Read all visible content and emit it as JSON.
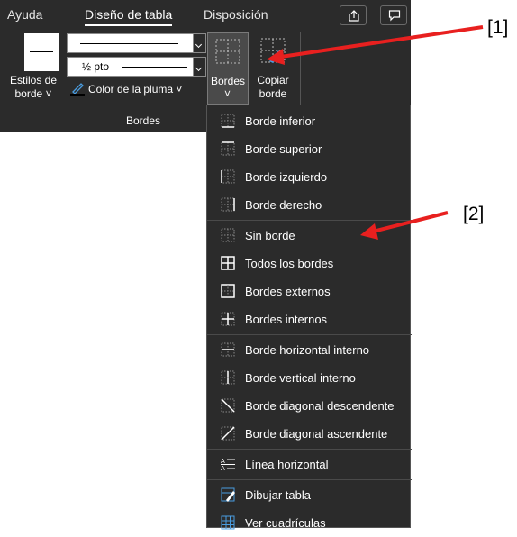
{
  "tabs": [
    "Ayuda",
    "Diseño de tabla",
    "Disposición"
  ],
  "ribbon": {
    "border_styles_label": [
      "Estilos de",
      "borde ˅"
    ],
    "line_weight_value": "½ pto",
    "pen_color_label": "Color de la pluma ˅",
    "borders_label": "Bordes",
    "borders_chevron": "˅",
    "copy_border_label": [
      "Copiar",
      "borde"
    ],
    "group_label": "Bordes"
  },
  "menu": [
    {
      "label": "Borde inferior",
      "icon": "border-bottom-icon"
    },
    {
      "label": "Borde superior",
      "icon": "border-top-icon"
    },
    {
      "label": "Borde izquierdo",
      "icon": "border-left-icon"
    },
    {
      "label": "Borde derecho",
      "icon": "border-right-icon"
    },
    {
      "label": "Sin borde",
      "icon": "no-border-icon"
    },
    {
      "label": "Todos los bordes",
      "icon": "all-borders-icon"
    },
    {
      "label": "Bordes externos",
      "icon": "outside-borders-icon"
    },
    {
      "label": "Bordes internos",
      "icon": "inside-borders-icon"
    },
    {
      "label": "Borde horizontal interno",
      "icon": "inside-horizontal-border-icon"
    },
    {
      "label": "Borde vertical interno",
      "icon": "inside-vertical-border-icon"
    },
    {
      "label": "Borde diagonal descendente",
      "icon": "diagonal-down-border-icon"
    },
    {
      "label": "Borde diagonal ascendente",
      "icon": "diagonal-up-border-icon"
    },
    {
      "label": "Línea horizontal",
      "icon": "horizontal-line-icon"
    },
    {
      "label": "Dibujar tabla",
      "icon": "draw-table-icon"
    },
    {
      "label": "Ver cuadrículas",
      "icon": "view-gridlines-icon"
    }
  ],
  "annotations": [
    "[1]",
    "[2]"
  ],
  "colors": {
    "ribbon_bg": "#2b2b2b",
    "arrow": "#e8201f",
    "pen_accent": "#4a9de0"
  }
}
